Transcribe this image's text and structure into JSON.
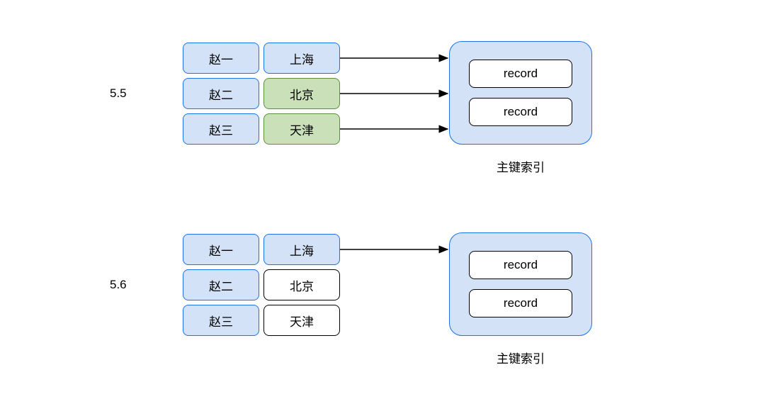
{
  "diagram": {
    "top": {
      "version": "5.5",
      "rows": [
        {
          "name": "赵一",
          "city": "上海",
          "cityStyle": "blue"
        },
        {
          "name": "赵二",
          "city": "北京",
          "cityStyle": "green"
        },
        {
          "name": "赵三",
          "city": "天津",
          "cityStyle": "green"
        }
      ],
      "index": {
        "records": [
          "record",
          "record"
        ],
        "caption": "主键索引"
      }
    },
    "bottom": {
      "version": "5.6",
      "rows": [
        {
          "name": "赵一",
          "city": "上海",
          "cityStyle": "blue"
        },
        {
          "name": "赵二",
          "city": "北京",
          "cityStyle": "white"
        },
        {
          "name": "赵三",
          "city": "天津",
          "cityStyle": "white"
        }
      ],
      "index": {
        "records": [
          "record",
          "record"
        ],
        "caption": "主键索引"
      }
    }
  }
}
